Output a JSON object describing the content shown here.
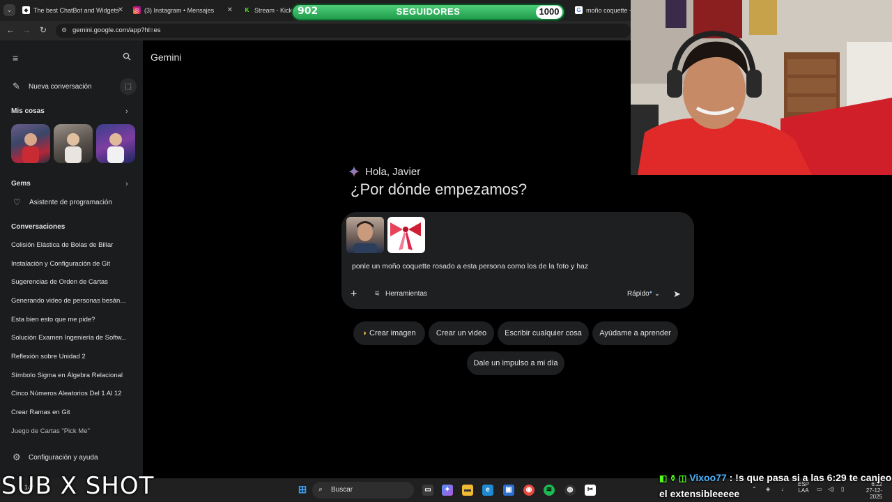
{
  "browser": {
    "tabs": [
      {
        "title": "The best ChatBot and Widgets"
      },
      {
        "title": "(3) Instagram • Mensajes"
      },
      {
        "title": "Stream - Kick D"
      },
      {
        "title": "moño coquette -"
      }
    ],
    "url": "gemini.google.com/app?hl=es"
  },
  "followers_overlay": {
    "current": "902",
    "label": "SEGUIDORES",
    "goal": "1000"
  },
  "sidebar": {
    "new_chat_label": "Nueva conversación",
    "my_stuff_label": "Mis cosas",
    "gems_label": "Gems",
    "gem_item_label": "Asistente de programación",
    "conversations_label": "Conversaciones",
    "conversations": [
      "Colisión Elástica de Bolas de Billar",
      "Instalación y Configuración de Git",
      "Sugerencias de Orden de Cartas",
      "Generando video de personas besán...",
      "Esta bien esto que me pide?",
      "Solución Examen Ingeniería de Softw...",
      "Reflexión sobre Unidad 2",
      "Símbolo Sigma en Álgebra Relacional",
      "Cinco Números Aleatorios Del 1 Al 12",
      "Crear Ramas en Git",
      "Juego de Cartas \"Pick Me\""
    ],
    "settings_label": "Configuración y ayuda"
  },
  "main": {
    "app_title": "Gemini",
    "greeting": "Hola, Javier",
    "headline": "¿Por dónde empezamos?",
    "prompt_text": "ponle un moño coquette rosado a esta persona como los  de la foto  y haz",
    "tools_label": "Herramientas",
    "mode_label": "Rápido",
    "chips": [
      "Crear imagen",
      "Crear un video",
      "Escribir cualquier cosa",
      "Ayúdame a aprender",
      "Dale un impulso a mi día"
    ]
  },
  "taskbar": {
    "search_placeholder": "Buscar",
    "lang_top": "ESP",
    "lang_bottom": "LAA",
    "time": "6:22",
    "date": "27-12-2025",
    "weather": "14°"
  },
  "overlay_text": {
    "sub_shot": "SUB X SHOT",
    "chat_user": "Vixoo77",
    "chat_message_1": " : !s que pasa si a las 6:29 te canjeo",
    "chat_message_2": "el extensibleeeee"
  }
}
